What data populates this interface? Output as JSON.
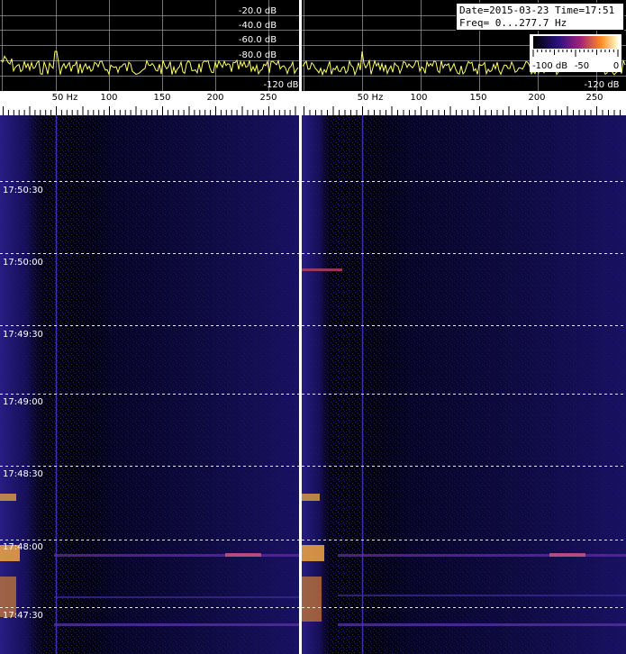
{
  "info": {
    "line1": "Date=2015-03-23 Time=17:51",
    "line2": "Freq= 0...277.7 Hz"
  },
  "colorbar": {
    "min_label": "-100 dB",
    "mid_label": "-50",
    "max_label": "0"
  },
  "spectrum": {
    "db_labels": [
      "-20.0 dB",
      "-40.0 dB",
      "-60.0 dB",
      "-80.0 dB",
      "-120 dB"
    ],
    "right_db_label": "-120 dB"
  },
  "freq_axis": {
    "labels": [
      "50 Hz",
      "100",
      "150",
      "200",
      "250"
    ]
  },
  "waterfall": {
    "time_labels": [
      "17:50:30",
      "17:50:00",
      "17:49:30",
      "17:49:00",
      "17:48:30",
      "17:48:00",
      "17:47:30"
    ]
  },
  "colors": {
    "trace": "#ffff66",
    "grid": "#9a9a9a",
    "marker": "#ff3030",
    "waterfall_bg": "#000010",
    "noise": "#1c1470",
    "hot": "#ffa030"
  }
}
